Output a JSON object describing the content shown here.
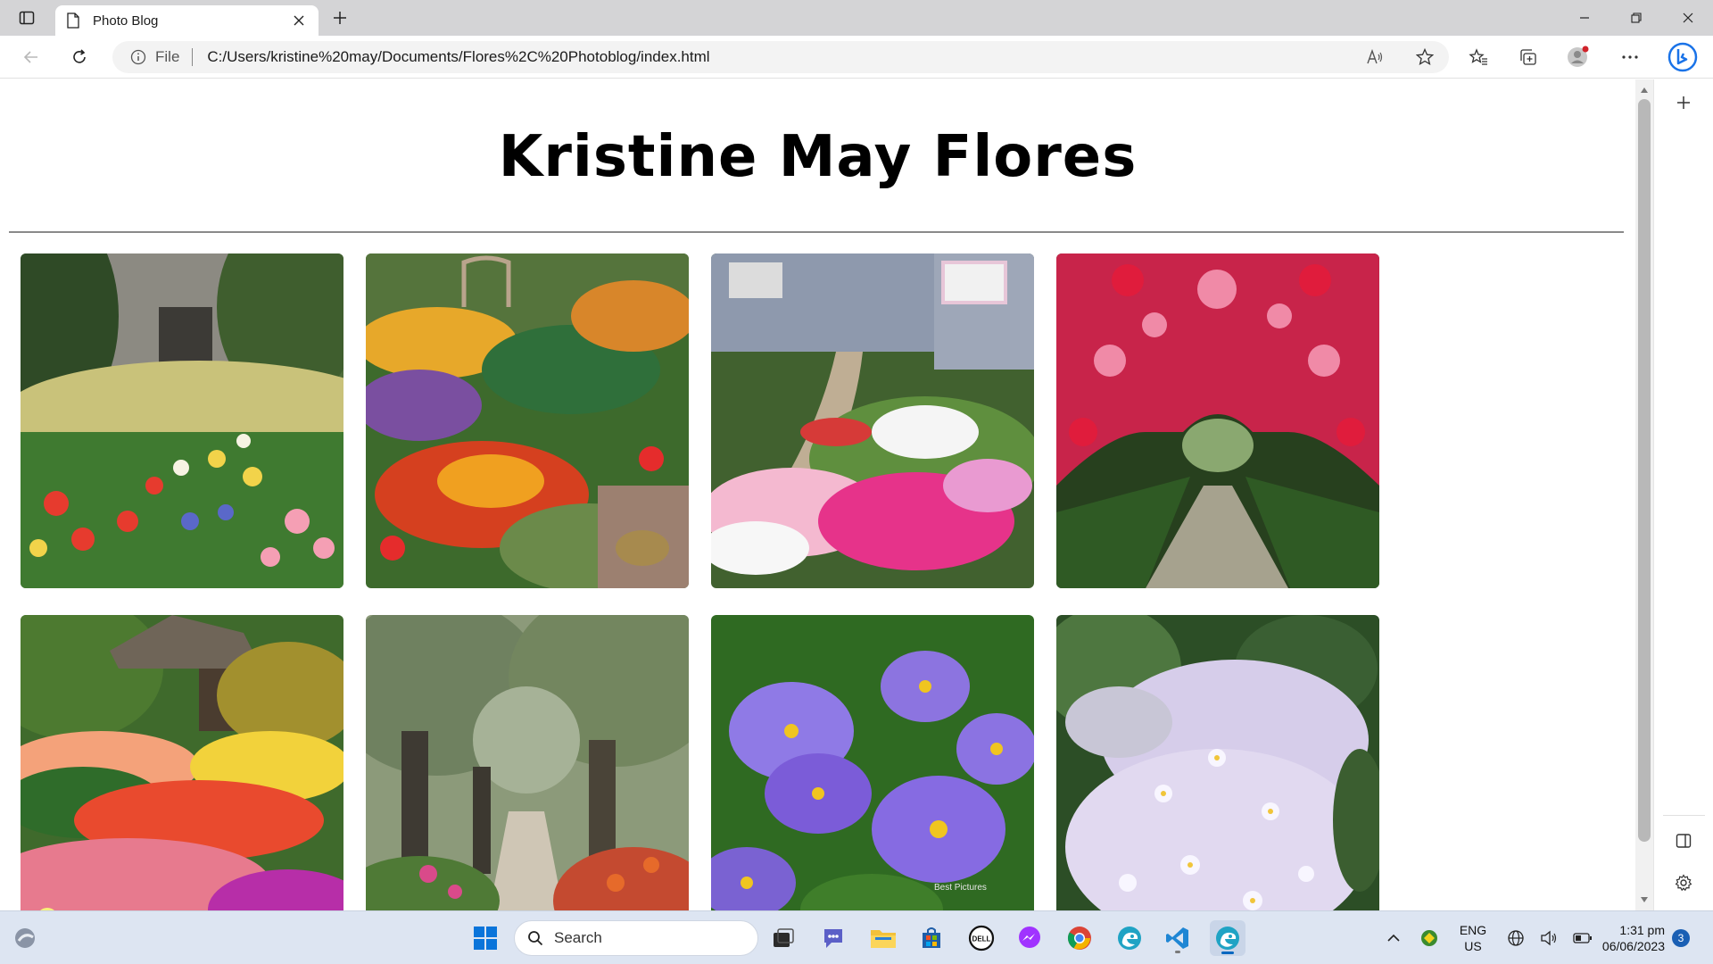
{
  "browser": {
    "tab_title": "Photo Blog",
    "address": {
      "scheme_label": "File",
      "url": "C:/Users/kristine%20may/Documents/Flores%2C%20Photoblog/index.html"
    }
  },
  "page": {
    "title": "Kristine May Flores",
    "photos": [
      {
        "subject": "tulip garden with house"
      },
      {
        "subject": "colorful vegetable and flower garden"
      },
      {
        "subject": "cottage garden path with pink flowers"
      },
      {
        "subject": "rose arch tunnel walkway"
      },
      {
        "subject": "tulip beds with wooden shelter"
      },
      {
        "subject": "olive tree garden path"
      },
      {
        "subject": "purple aster flowers"
      },
      {
        "subject": "white daisy shrub"
      }
    ],
    "photo_watermark": "Best Pictures"
  },
  "taskbar": {
    "search_label": "Search",
    "language_line1": "ENG",
    "language_line2": "US",
    "time": "1:31 pm",
    "date": "06/06/2023",
    "notification_count": "3"
  },
  "colors": {
    "accent": "#0067c0",
    "titlebar": "#d4d4d6",
    "taskbar": "#dde5f2"
  }
}
